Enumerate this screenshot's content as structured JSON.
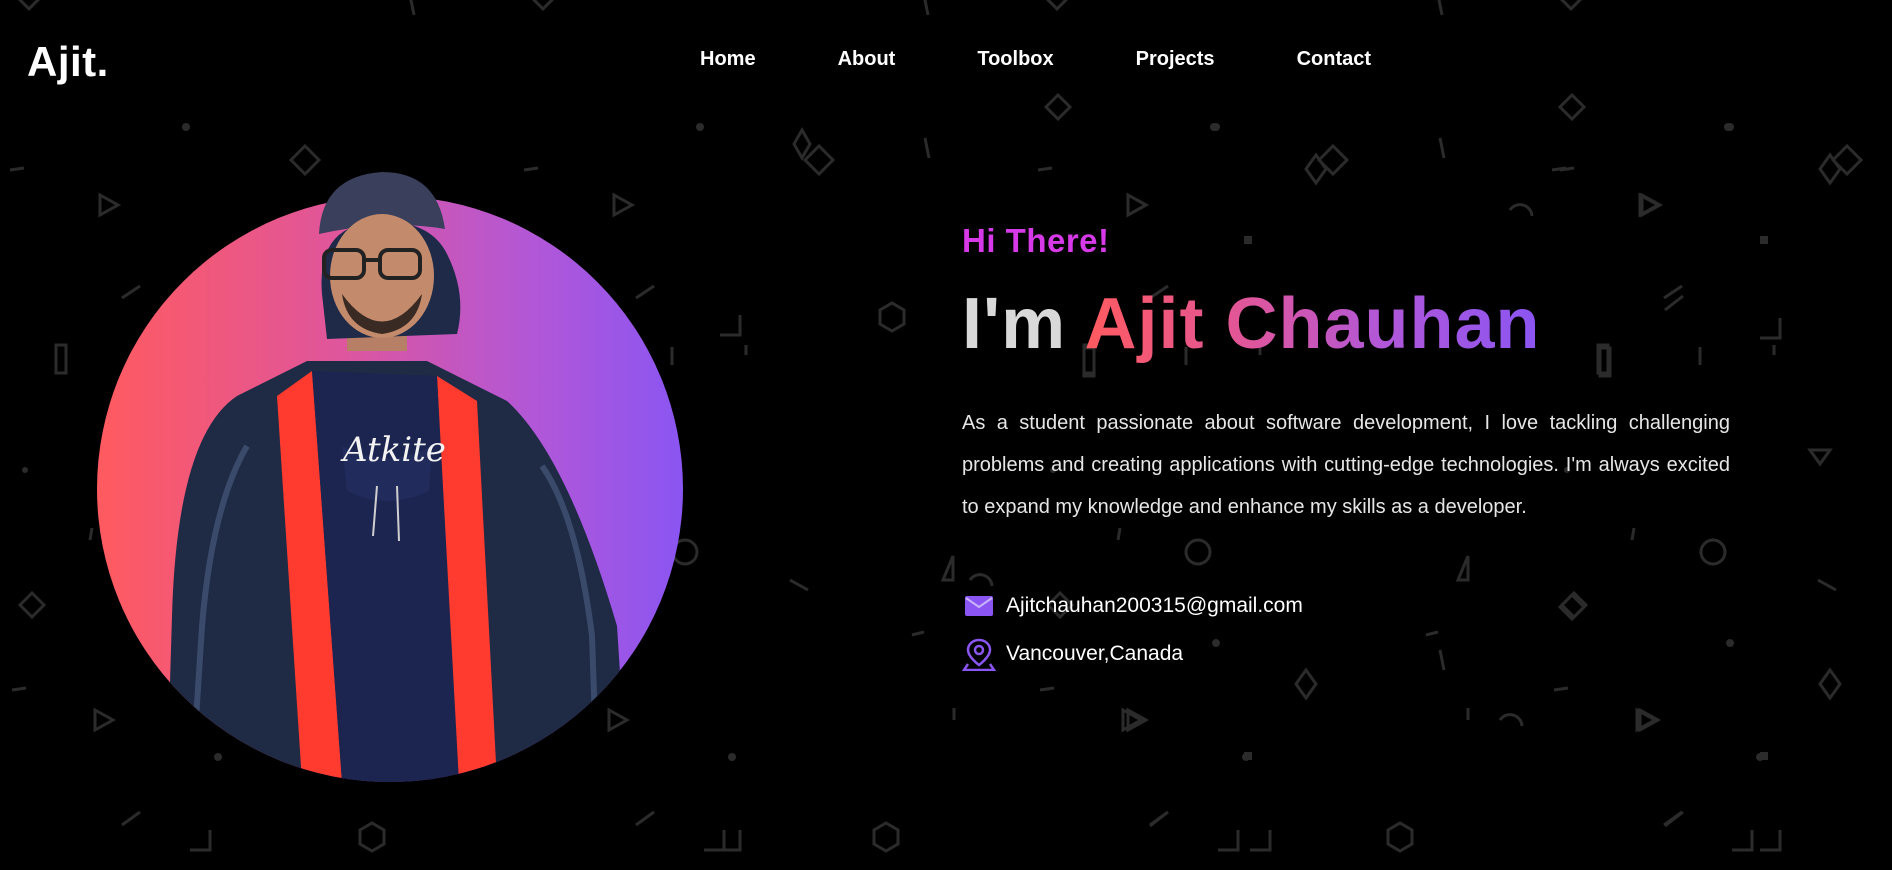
{
  "header": {
    "logo": "Ajit.",
    "nav": [
      "Home",
      "About",
      "Toolbox",
      "Projects",
      "Contact"
    ]
  },
  "hero": {
    "greeting": "Hi There!",
    "title_prefix": "I'm",
    "title_name": "Ajit Chauhan",
    "bio": "As a student passionate about software development, I love tackling challenging problems and creating applications with cutting-edge technologies. I'm always excited to expand my knowledge and enhance my skills as a developer.",
    "contacts": [
      {
        "icon": "mail-icon",
        "text": "Ajitchauhan200315@gmail.com"
      },
      {
        "icon": "location-pin-icon",
        "text": "Vancouver,Canada"
      }
    ]
  },
  "colors": {
    "background": "#000000",
    "greeting": "#d63ae8",
    "gradient_start": "#ff5a5f",
    "gradient_end": "#8a55f2",
    "icon_accent": "#8a55f2"
  },
  "avatar": {
    "icon": "profile-photo"
  },
  "background": {
    "icon": "geometric-pattern"
  }
}
